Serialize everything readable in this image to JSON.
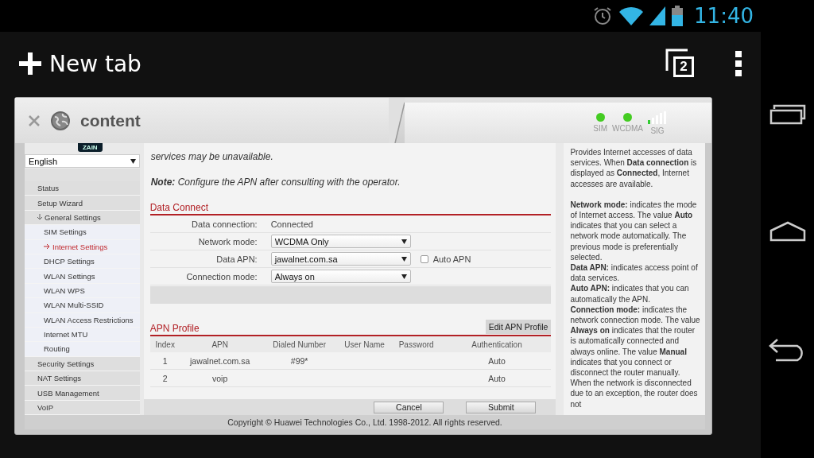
{
  "status_bar": {
    "time": "11:40"
  },
  "browser": {
    "new_tab": "New tab",
    "tab_count": "2"
  },
  "tab": {
    "title": "content"
  },
  "router_status": {
    "indicators": [
      {
        "label": "SIM",
        "color": "#44cc22"
      },
      {
        "label": "WCDMA",
        "color": "#44cc22"
      }
    ],
    "signal_label": "SIG"
  },
  "sidebar": {
    "logo": "ZAIN",
    "language": "English",
    "items": [
      {
        "label": "Status",
        "selected": false
      },
      {
        "label": "Setup Wizard",
        "selected": false
      },
      {
        "label": "General Settings",
        "selected": false,
        "expanded": true,
        "children": [
          {
            "label": "SIM Settings",
            "selected": false
          },
          {
            "label": "Internet Settings",
            "selected": true
          },
          {
            "label": "DHCP Settings",
            "selected": false
          },
          {
            "label": "WLAN Settings",
            "selected": false
          },
          {
            "label": "WLAN WPS",
            "selected": false
          },
          {
            "label": "WLAN Multi-SSID",
            "selected": false
          },
          {
            "label": "WLAN Access Restrictions",
            "selected": false
          },
          {
            "label": "Internet MTU",
            "selected": false
          },
          {
            "label": "Routing",
            "selected": false
          }
        ]
      },
      {
        "label": "Security Settings",
        "selected": false
      },
      {
        "label": "NAT Settings",
        "selected": false
      },
      {
        "label": "USB Management",
        "selected": false
      },
      {
        "label": "VoIP",
        "selected": false
      }
    ]
  },
  "main": {
    "intro": "services may be unavailable.",
    "note": "**Note:** Configure the APN after consulting with the operator.",
    "data_connect": {
      "title": "Data Connect",
      "rows": [
        {
          "kind": "text",
          "label": "Data connection:",
          "value": "Connected"
        },
        {
          "kind": "select",
          "label": "Network mode:",
          "value": "WCDMA Only"
        },
        {
          "kind": "select",
          "label": "Data APN:",
          "value": "jawalnet.com.sa",
          "checkbox": {
            "label": "Auto APN",
            "checked": false
          }
        },
        {
          "kind": "select",
          "label": "Connection mode:",
          "value": "Always on"
        }
      ]
    },
    "apn_profile": {
      "title": "APN Profile",
      "edit_button": "Edit APN Profile",
      "columns": [
        "Index",
        "APN",
        "Dialed Number",
        "User Name",
        "Password",
        "Authentication"
      ],
      "rows": [
        [
          "1",
          "jawalnet.com.sa",
          "#99*",
          "",
          "",
          "Auto"
        ],
        [
          "2",
          "voip",
          "",
          "",
          "",
          "Auto"
        ]
      ]
    },
    "buttons": [
      "Cancel",
      "Submit"
    ]
  },
  "help": [
    "Provides Internet accesses of data services. When **Data connection** is displayed as **Connected**, Internet accesses are available.",
    "**Network mode:** indicates the mode of Internet access. The value **Auto** indicates that you can select a network mode automatically. The previous mode is preferentially selected.",
    "**Data APN:** indicates access point of data services.",
    "**Auto APN:** indicates that you can automatically the APN.",
    "**Connection mode:** indicates the network connection mode. The value **Always on** indicates that the router is automatically connected and always online. The value **Manual** indicates that you connect or disconnect the router manually. When the network is disconnected due to an exception, the router does not"
  ],
  "footer": "Copyright © Huawei Technologies Co., Ltd. 1998-2012. All rights reserved."
}
